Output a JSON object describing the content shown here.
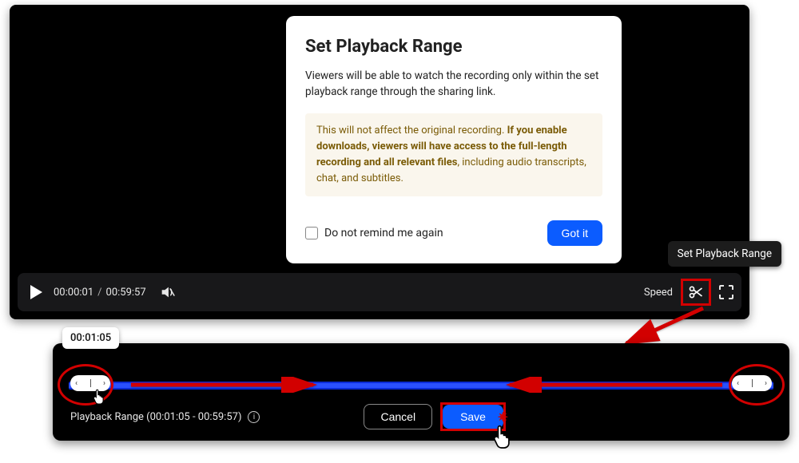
{
  "modal": {
    "title": "Set Playback Range",
    "description": "Viewers will be able to watch the recording only within the set playback range through the sharing link.",
    "warn_pre": "This will not affect the original recording. ",
    "warn_bold": "If you enable downloads, viewers will have access to the full-length recording and all relevant files",
    "warn_post": ", including audio transcripts, chat, and subtitles.",
    "checkbox_label": "Do not remind me again",
    "gotit_label": "Got it"
  },
  "tooltip": {
    "scissors": "Set Playback Range"
  },
  "controls": {
    "current_time": "00:00:01",
    "total_time": "00:59:57",
    "speed_label": "Speed"
  },
  "range": {
    "tooltip_time": "00:01:05",
    "label_prefix": "Playback Range (",
    "start_time": "00:01:05",
    "sep": " - ",
    "end_time": "00:59:57",
    "label_suffix": ")",
    "cancel_label": "Cancel",
    "save_label": "Save"
  },
  "colors": {
    "accent": "#0b5cff",
    "annotation": "#d20000",
    "warn_bg": "#faf6ed",
    "warn_text": "#7a5b06"
  }
}
